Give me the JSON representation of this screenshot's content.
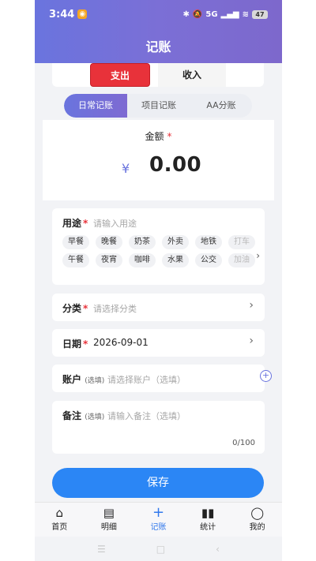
{
  "status": {
    "time": "3:44",
    "network": "5G",
    "battery": "47"
  },
  "header": {
    "title": "记账"
  },
  "type_toggle": {
    "expense": "支出",
    "income": "收入"
  },
  "mode_tabs": [
    "日常记账",
    "项目记账",
    "AA分账"
  ],
  "amount": {
    "label": "金额",
    "required": "*",
    "currency": "¥",
    "value": "0.00"
  },
  "purpose": {
    "label": "用途",
    "required": "*",
    "placeholder": "请输入用途",
    "chips_row1": [
      "早餐",
      "晚餐",
      "奶茶",
      "外卖",
      "地铁",
      "打车"
    ],
    "chips_row2": [
      "午餐",
      "夜宵",
      "咖啡",
      "水果",
      "公交",
      "加油"
    ]
  },
  "category": {
    "label": "分类",
    "required": "*",
    "placeholder": "请选择分类"
  },
  "date": {
    "label": "日期",
    "required": "*",
    "value": "2026-09-01"
  },
  "account": {
    "label": "账户",
    "optional": "(选填)",
    "placeholder": "请选择账户（选填）"
  },
  "note": {
    "label": "备注",
    "optional": "(选填)",
    "placeholder": "请输入备注（选填）",
    "counter": "0/100"
  },
  "save_label": "保存",
  "nav": [
    {
      "label": "首页",
      "icon": "home-icon"
    },
    {
      "label": "明细",
      "icon": "list-icon"
    },
    {
      "label": "记账",
      "icon": "plus-icon"
    },
    {
      "label": "统计",
      "icon": "chart-icon"
    },
    {
      "label": "我的",
      "icon": "user-icon"
    }
  ],
  "colors": {
    "accent": "#6a74de",
    "expense": "#e8323a",
    "save": "#2b86f5",
    "nav_active": "#3178ec"
  }
}
